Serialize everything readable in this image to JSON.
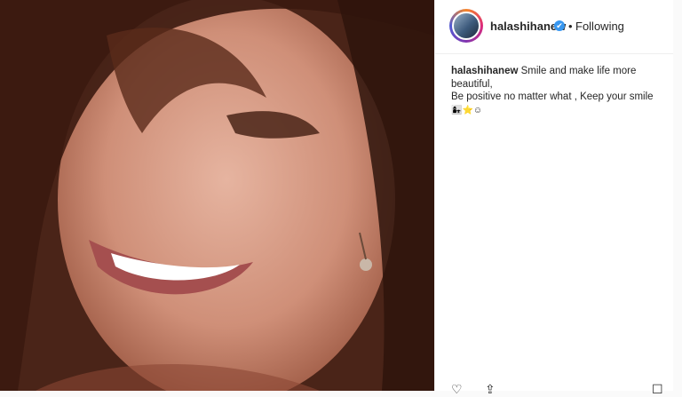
{
  "post": {
    "username": "halashihanew",
    "verified_icon": "✔",
    "separator": "•",
    "follow_status": "Following",
    "caption": {
      "username": "halashihanew",
      "line1": "Smile and make life more beautiful,",
      "line2": "Be positive no matter what , Keep your smile",
      "emojis": "👩‍👧⭐☺"
    }
  },
  "icons": {
    "like": "heart-icon",
    "share": "share-icon",
    "save": "bookmark-icon"
  },
  "colors": {
    "verified": "#3897f0",
    "text": "#262626",
    "border": "#efefef"
  }
}
